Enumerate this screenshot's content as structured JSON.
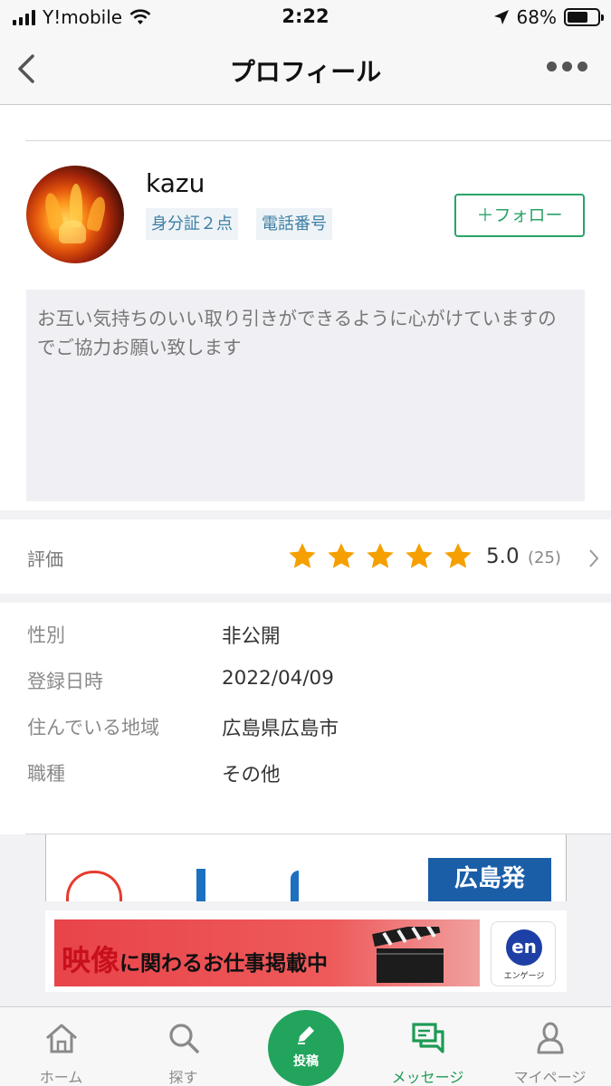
{
  "status_bar": {
    "carrier": "Y!mobile",
    "time": "2:22",
    "battery": "68%",
    "battery_level": 0.68
  },
  "nav": {
    "title": "プロフィール"
  },
  "profile": {
    "username": "kazu",
    "badges": [
      "身分証２点",
      "電話番号"
    ],
    "follow_label": "＋フォロー",
    "bio": "お互い気持ちのいい取り引きができるように心がけていますのでご協力お願い致します"
  },
  "rating": {
    "label": "評価",
    "stars": 5,
    "score": "5.0",
    "count": "(25)"
  },
  "info": [
    {
      "label": "性別",
      "value": "非公開"
    },
    {
      "label": "登録日時",
      "value": "2022/04/09"
    },
    {
      "label": "住んでいる地域",
      "value": "広島県広島市"
    },
    {
      "label": "職種",
      "value": "その他"
    }
  ],
  "ads": {
    "ad1_box_text": "広島発",
    "ad2_big": "映像",
    "ad2_rest": "に関わるお仕事掲載中",
    "ad2_logo": "en",
    "ad2_logo_sub": "エンゲージ"
  },
  "tab_bar": {
    "tabs": [
      {
        "label": "ホーム",
        "icon": "home-icon"
      },
      {
        "label": "探す",
        "icon": "search-icon"
      },
      {
        "label": "投稿",
        "icon": "pencil-icon"
      },
      {
        "label": "メッセージ",
        "icon": "message-icon"
      },
      {
        "label": "マイページ",
        "icon": "person-icon"
      }
    ],
    "active": "メッセージ"
  },
  "colors": {
    "accent_green": "#22a45d",
    "star_orange": "#f5a000",
    "badge_text": "#3d7fa5"
  }
}
